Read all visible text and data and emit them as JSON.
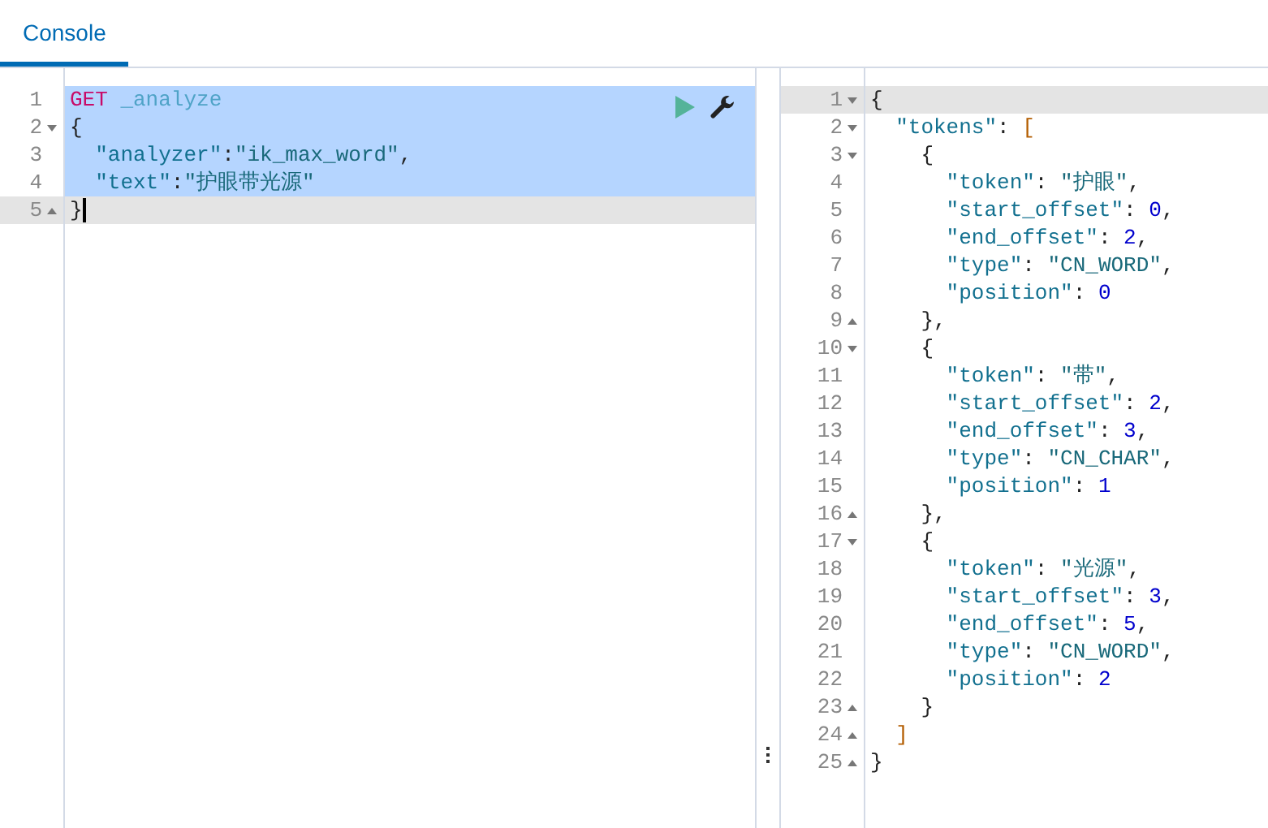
{
  "tabs": [
    {
      "label": "Console",
      "selected": true
    }
  ],
  "request": {
    "lines": [
      {
        "number": "1",
        "fold_start": false,
        "fold_end": false,
        "selected": true,
        "active": false,
        "cursor": false,
        "tokens": [
          {
            "kind": "method",
            "text": "GET"
          },
          {
            "kind": "url",
            "text": " _analyze"
          }
        ]
      },
      {
        "number": "2",
        "fold_start": true,
        "fold_end": false,
        "selected": true,
        "active": false,
        "cursor": false,
        "tokens": [
          {
            "kind": "punct",
            "text": "{"
          }
        ]
      },
      {
        "number": "3",
        "fold_start": false,
        "fold_end": false,
        "selected": true,
        "active": false,
        "cursor": false,
        "tokens": [
          {
            "kind": "key",
            "text": "  \"analyzer\""
          },
          {
            "kind": "punct",
            "text": ":"
          },
          {
            "kind": "string",
            "text": "\"ik_max_word\""
          },
          {
            "kind": "punct",
            "text": ","
          }
        ]
      },
      {
        "number": "4",
        "fold_start": false,
        "fold_end": false,
        "selected": true,
        "active": false,
        "cursor": false,
        "tokens": [
          {
            "kind": "key",
            "text": "  \"text\""
          },
          {
            "kind": "punct",
            "text": ":"
          },
          {
            "kind": "string",
            "text": "\"护眼带光源\""
          }
        ]
      },
      {
        "number": "5",
        "fold_start": false,
        "fold_end": true,
        "selected": false,
        "active": true,
        "cursor": true,
        "tokens": [
          {
            "kind": "punct",
            "text": "}"
          }
        ]
      }
    ]
  },
  "response": {
    "lines": [
      {
        "number": "1",
        "fold_start": true,
        "fold_end": false,
        "active": true,
        "tokens": [
          {
            "kind": "punct",
            "text": "{"
          }
        ]
      },
      {
        "number": "2",
        "fold_start": true,
        "fold_end": false,
        "active": false,
        "tokens": [
          {
            "kind": "key",
            "text": "  \"tokens\""
          },
          {
            "kind": "punct",
            "text": ": "
          },
          {
            "kind": "bracket",
            "text": "["
          }
        ]
      },
      {
        "number": "3",
        "fold_start": true,
        "fold_end": false,
        "active": false,
        "tokens": [
          {
            "kind": "punct",
            "text": "    {"
          }
        ]
      },
      {
        "number": "4",
        "fold_start": false,
        "fold_end": false,
        "active": false,
        "tokens": [
          {
            "kind": "key",
            "text": "      \"token\""
          },
          {
            "kind": "punct",
            "text": ": "
          },
          {
            "kind": "string",
            "text": "\"护眼\""
          },
          {
            "kind": "punct",
            "text": ","
          }
        ]
      },
      {
        "number": "5",
        "fold_start": false,
        "fold_end": false,
        "active": false,
        "tokens": [
          {
            "kind": "key",
            "text": "      \"start_offset\""
          },
          {
            "kind": "punct",
            "text": ": "
          },
          {
            "kind": "number",
            "text": "0"
          },
          {
            "kind": "punct",
            "text": ","
          }
        ]
      },
      {
        "number": "6",
        "fold_start": false,
        "fold_end": false,
        "active": false,
        "tokens": [
          {
            "kind": "key",
            "text": "      \"end_offset\""
          },
          {
            "kind": "punct",
            "text": ": "
          },
          {
            "kind": "number",
            "text": "2"
          },
          {
            "kind": "punct",
            "text": ","
          }
        ]
      },
      {
        "number": "7",
        "fold_start": false,
        "fold_end": false,
        "active": false,
        "tokens": [
          {
            "kind": "key",
            "text": "      \"type\""
          },
          {
            "kind": "punct",
            "text": ": "
          },
          {
            "kind": "string",
            "text": "\"CN_WORD\""
          },
          {
            "kind": "punct",
            "text": ","
          }
        ]
      },
      {
        "number": "8",
        "fold_start": false,
        "fold_end": false,
        "active": false,
        "tokens": [
          {
            "kind": "key",
            "text": "      \"position\""
          },
          {
            "kind": "punct",
            "text": ": "
          },
          {
            "kind": "number",
            "text": "0"
          }
        ]
      },
      {
        "number": "9",
        "fold_start": false,
        "fold_end": true,
        "active": false,
        "tokens": [
          {
            "kind": "punct",
            "text": "    },"
          }
        ]
      },
      {
        "number": "10",
        "fold_start": true,
        "fold_end": false,
        "active": false,
        "tokens": [
          {
            "kind": "punct",
            "text": "    {"
          }
        ]
      },
      {
        "number": "11",
        "fold_start": false,
        "fold_end": false,
        "active": false,
        "tokens": [
          {
            "kind": "key",
            "text": "      \"token\""
          },
          {
            "kind": "punct",
            "text": ": "
          },
          {
            "kind": "string",
            "text": "\"带\""
          },
          {
            "kind": "punct",
            "text": ","
          }
        ]
      },
      {
        "number": "12",
        "fold_start": false,
        "fold_end": false,
        "active": false,
        "tokens": [
          {
            "kind": "key",
            "text": "      \"start_offset\""
          },
          {
            "kind": "punct",
            "text": ": "
          },
          {
            "kind": "number",
            "text": "2"
          },
          {
            "kind": "punct",
            "text": ","
          }
        ]
      },
      {
        "number": "13",
        "fold_start": false,
        "fold_end": false,
        "active": false,
        "tokens": [
          {
            "kind": "key",
            "text": "      \"end_offset\""
          },
          {
            "kind": "punct",
            "text": ": "
          },
          {
            "kind": "number",
            "text": "3"
          },
          {
            "kind": "punct",
            "text": ","
          }
        ]
      },
      {
        "number": "14",
        "fold_start": false,
        "fold_end": false,
        "active": false,
        "tokens": [
          {
            "kind": "key",
            "text": "      \"type\""
          },
          {
            "kind": "punct",
            "text": ": "
          },
          {
            "kind": "string",
            "text": "\"CN_CHAR\""
          },
          {
            "kind": "punct",
            "text": ","
          }
        ]
      },
      {
        "number": "15",
        "fold_start": false,
        "fold_end": false,
        "active": false,
        "tokens": [
          {
            "kind": "key",
            "text": "      \"position\""
          },
          {
            "kind": "punct",
            "text": ": "
          },
          {
            "kind": "number",
            "text": "1"
          }
        ]
      },
      {
        "number": "16",
        "fold_start": false,
        "fold_end": true,
        "active": false,
        "tokens": [
          {
            "kind": "punct",
            "text": "    },"
          }
        ]
      },
      {
        "number": "17",
        "fold_start": true,
        "fold_end": false,
        "active": false,
        "tokens": [
          {
            "kind": "punct",
            "text": "    {"
          }
        ]
      },
      {
        "number": "18",
        "fold_start": false,
        "fold_end": false,
        "active": false,
        "tokens": [
          {
            "kind": "key",
            "text": "      \"token\""
          },
          {
            "kind": "punct",
            "text": ": "
          },
          {
            "kind": "string",
            "text": "\"光源\""
          },
          {
            "kind": "punct",
            "text": ","
          }
        ]
      },
      {
        "number": "19",
        "fold_start": false,
        "fold_end": false,
        "active": false,
        "tokens": [
          {
            "kind": "key",
            "text": "      \"start_offset\""
          },
          {
            "kind": "punct",
            "text": ": "
          },
          {
            "kind": "number",
            "text": "3"
          },
          {
            "kind": "punct",
            "text": ","
          }
        ]
      },
      {
        "number": "20",
        "fold_start": false,
        "fold_end": false,
        "active": false,
        "tokens": [
          {
            "kind": "key",
            "text": "      \"end_offset\""
          },
          {
            "kind": "punct",
            "text": ": "
          },
          {
            "kind": "number",
            "text": "5"
          },
          {
            "kind": "punct",
            "text": ","
          }
        ]
      },
      {
        "number": "21",
        "fold_start": false,
        "fold_end": false,
        "active": false,
        "tokens": [
          {
            "kind": "key",
            "text": "      \"type\""
          },
          {
            "kind": "punct",
            "text": ": "
          },
          {
            "kind": "string",
            "text": "\"CN_WORD\""
          },
          {
            "kind": "punct",
            "text": ","
          }
        ]
      },
      {
        "number": "22",
        "fold_start": false,
        "fold_end": false,
        "active": false,
        "tokens": [
          {
            "kind": "key",
            "text": "      \"position\""
          },
          {
            "kind": "punct",
            "text": ": "
          },
          {
            "kind": "number",
            "text": "2"
          }
        ]
      },
      {
        "number": "23",
        "fold_start": false,
        "fold_end": true,
        "active": false,
        "tokens": [
          {
            "kind": "punct",
            "text": "    }"
          }
        ]
      },
      {
        "number": "24",
        "fold_start": false,
        "fold_end": true,
        "active": false,
        "tokens": [
          {
            "kind": "bracket",
            "text": "  ]"
          }
        ]
      },
      {
        "number": "25",
        "fold_start": false,
        "fold_end": true,
        "active": false,
        "tokens": [
          {
            "kind": "punct",
            "text": "}"
          }
        ]
      }
    ]
  }
}
